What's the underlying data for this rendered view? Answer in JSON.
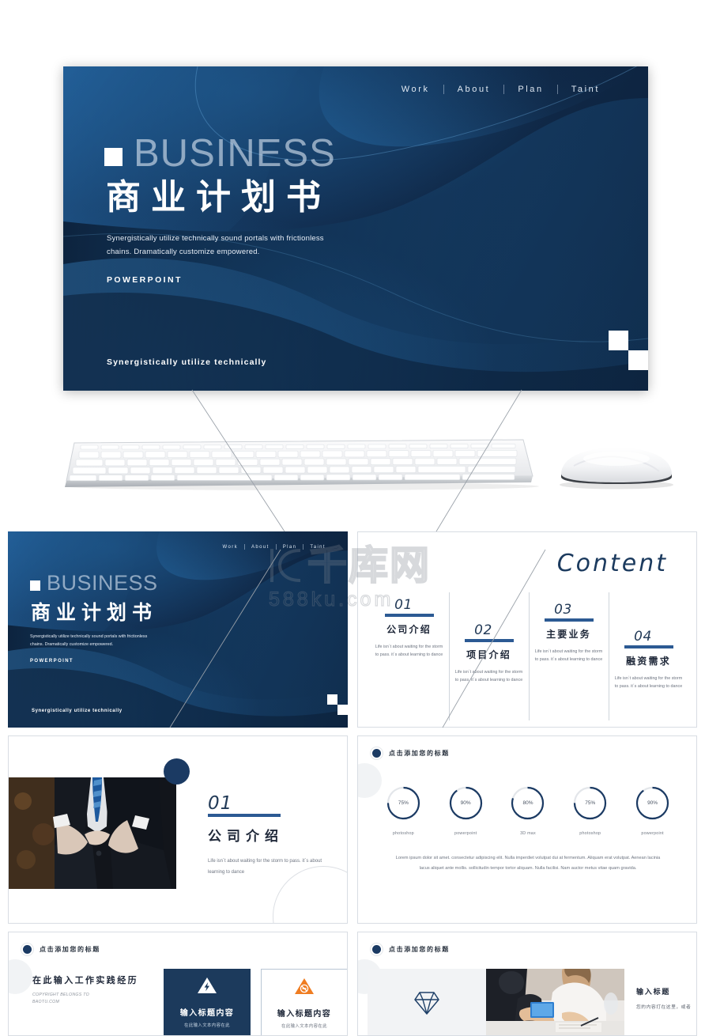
{
  "hero": {
    "nav": [
      "Work",
      "About",
      "Plan",
      "Taint"
    ],
    "brand_word": "BUSINESS",
    "cn_title": "商业计划书",
    "subtitle_line1": "Synergistically utilize technically sound portals with frictionless",
    "subtitle_line2": "chains.  Dramatically customize empowered.",
    "kicker": "POWERPOINT",
    "footer": "Synergistically  utilize  technically"
  },
  "content_slide": {
    "title": "Content",
    "items": [
      {
        "num": "01",
        "title": "公司介绍",
        "desc": "Life isn´t about waiting for the storm to pass. it´s about learning to dance"
      },
      {
        "num": "02",
        "title": "项目介绍",
        "desc": "Life isn´t about waiting for the storm to pass. it´s about learning to dance"
      },
      {
        "num": "03",
        "title": "主要业务",
        "desc": "Life isn´t about waiting for the storm to pass. it´s about learning to dance"
      },
      {
        "num": "04",
        "title": "融资需求",
        "desc": "Life isn´t about waiting for the storm to pass. it´s about learning to dance"
      }
    ]
  },
  "section_slide": {
    "num": "01",
    "title": "公司介绍",
    "desc": "Life isn´t about waiting for the storm to pass.  it´s about learning to dance"
  },
  "skills_slide": {
    "header": "点击添加您的标题",
    "paragraph": "Lorem ipsum dolor sit amet.  consectetur adipiscing elit.  Nulla imperdiet volutpat dui at fermentum. Aliquam erat volutpat.  Aenean lacinia lacus aliquet ante mollis.  sollicitudin tempor tortor aliquam. Nulla facilisi.  Nam auctor metus vitae quam gravida."
  },
  "experience_slide": {
    "header": "点击添加您的标题",
    "left_title": "在此输入工作实践经历",
    "copyright_line1": "COPYRIGHT BELONGS TO",
    "copyright_line2": "BAOTU.COM",
    "cards": [
      {
        "icon": "warning-bolt-icon",
        "title": "输入标题内容",
        "sub": "在此输入文本内容在此"
      },
      {
        "icon": "warning-no-smoking-icon",
        "title": "输入标题内容",
        "sub": "在此输入文本内容在此"
      }
    ]
  },
  "diamond_slide": {
    "header": "点击添加您的标题",
    "icon": "diamond-icon",
    "title": "输入标题",
    "sub": "您的内容打在这里，或者"
  },
  "watermark": {
    "cn": "千库网",
    "url": "588ku.com"
  },
  "chart_data": {
    "type": "pie",
    "title": "点击添加您的标题",
    "categories": [
      "photoshop",
      "powerpoint",
      "3D max",
      "photoshop",
      "powerpoint"
    ],
    "values": [
      75,
      90,
      80,
      75,
      90
    ],
    "value_labels": [
      "75%",
      "90%",
      "80%",
      "75%",
      "90%"
    ],
    "unit": "%",
    "ylim": [
      0,
      100
    ],
    "grid": false,
    "legend": "none",
    "arc_color": "#1b3a63",
    "track_color": "#e3e6ea"
  },
  "colors": {
    "navy_dark": "#0c1f38",
    "navy_mid": "#17406c",
    "blue_accent": "#2c5a93",
    "card_dark": "#1c3a5c",
    "orange": "#ef7d22",
    "page_bg": "#ffffff"
  }
}
